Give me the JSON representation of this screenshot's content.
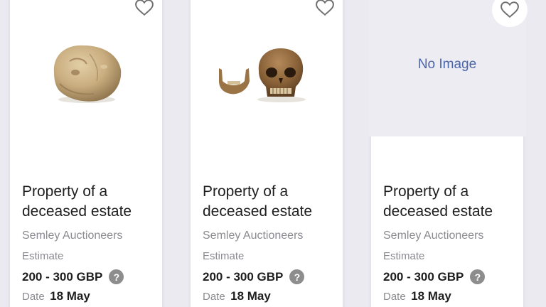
{
  "colors": {
    "page_background": "#eceaf1",
    "card_background": "#ffffff",
    "no_image_background": "#edecf3",
    "no_image_text": "#4b66a8",
    "secondary_text": "#8a8a90",
    "primary_text": "#1e1e1e",
    "help_icon": "#8d8d8d"
  },
  "lots": [
    {
      "image": "skull-fragment-photo",
      "title_line1": "Property of a",
      "title_line2": "deceased estate",
      "auction_house": "Semley Auctioneers",
      "estimate_label": "Estimate",
      "estimate_value": "200 - 300 GBP",
      "help_icon": "question-icon",
      "date_label": "Date",
      "date_value": "18 May",
      "favourite_icon": "heart-outline-icon"
    },
    {
      "image": "skull-and-jaw-photo",
      "title_line1": "Property of a",
      "title_line2": "deceased estate",
      "auction_house": "Semley Auctioneers",
      "estimate_label": "Estimate",
      "estimate_value": "200 - 300 GBP",
      "help_icon": "question-icon",
      "date_label": "Date",
      "date_value": "18 May",
      "favourite_icon": "heart-outline-icon"
    },
    {
      "image": "no-image-placeholder",
      "no_image_text": "No Image",
      "title_line1": "Property of a",
      "title_line2": "deceased estate",
      "auction_house": "Semley Auctioneers",
      "estimate_label": "Estimate",
      "estimate_value": "200 - 300 GBP",
      "help_icon": "question-icon",
      "date_label": "Date",
      "date_value": "18 May",
      "favourite_icon": "heart-outline-icon"
    }
  ]
}
